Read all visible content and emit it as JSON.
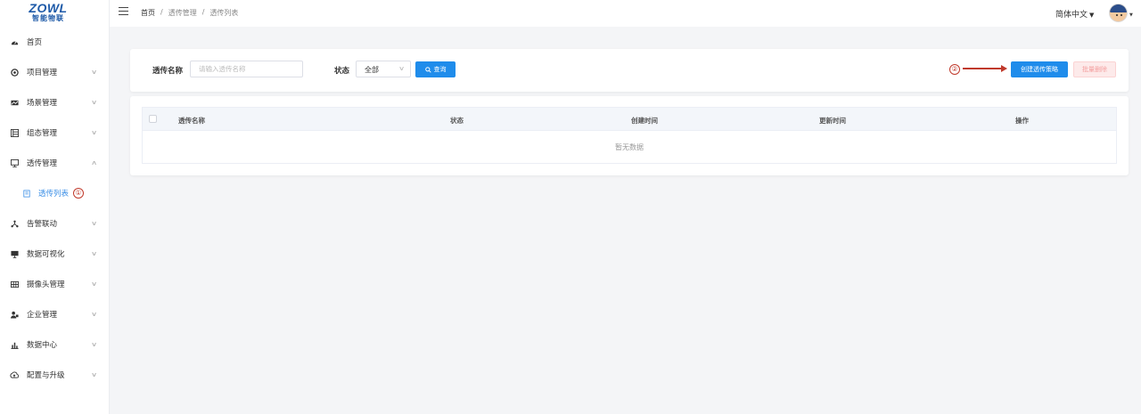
{
  "logo": {
    "mark": "ZOWL",
    "subtitle": "智能物联"
  },
  "header": {
    "breadcrumb": [
      "首页",
      "透传管理",
      "透传列表"
    ],
    "language": "简体中文"
  },
  "sidebar": {
    "items": [
      {
        "label": "首页",
        "icon": "dashboard-icon"
      },
      {
        "label": "项目管理",
        "icon": "project-icon"
      },
      {
        "label": "场景管理",
        "icon": "scene-icon"
      },
      {
        "label": "组态管理",
        "icon": "config-icon"
      },
      {
        "label": "透传管理",
        "icon": "monitor-icon"
      },
      {
        "label": "透传列表",
        "icon": "list-icon",
        "annotation": "①"
      },
      {
        "label": "告警联动",
        "icon": "alarm-icon"
      },
      {
        "label": "数据可视化",
        "icon": "visual-icon"
      },
      {
        "label": "摄像头管理",
        "icon": "camera-icon"
      },
      {
        "label": "企业管理",
        "icon": "enterprise-icon"
      },
      {
        "label": "数据中心",
        "icon": "chart-icon"
      },
      {
        "label": "配置与升级",
        "icon": "upgrade-icon"
      }
    ]
  },
  "search": {
    "name_label": "透传名称",
    "name_placeholder": "请输入透传名称",
    "status_label": "状态",
    "status_value": "全部",
    "query_label": "查询",
    "create_label": "创建透传策略",
    "batch_delete_label": "批量删除",
    "annotation": "②"
  },
  "table": {
    "columns": [
      "透传名称",
      "状态",
      "创建时间",
      "更新时间",
      "操作"
    ],
    "rows": [],
    "empty_text": "暂无数据"
  },
  "colors": {
    "primary": "#1f8ceb",
    "active_nav": "#3a8ee6",
    "annotation": "#c0392b",
    "danger_light": "#fdeaea"
  }
}
